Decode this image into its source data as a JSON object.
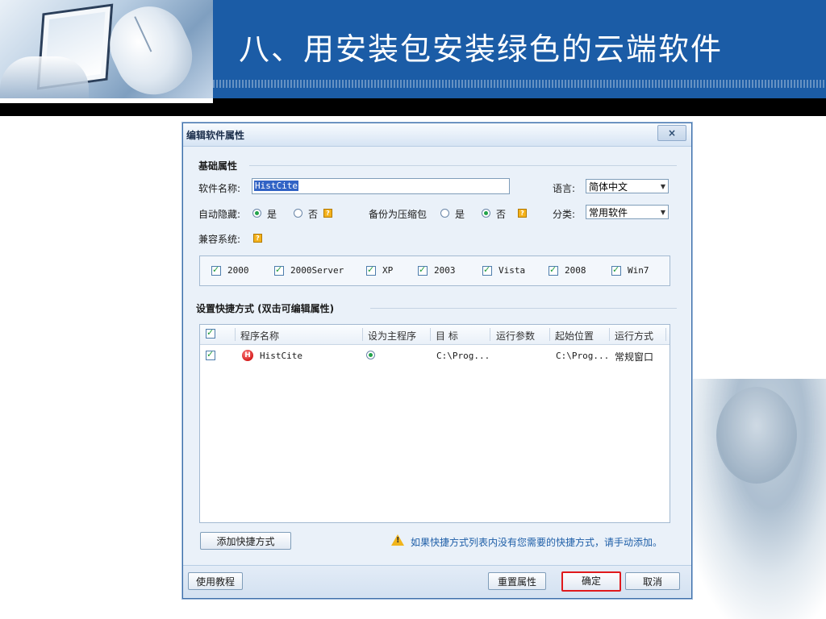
{
  "slide": {
    "title": "八、用安装包安装绿色的云端软件"
  },
  "dialog": {
    "title": "编辑软件属性",
    "close_label": "×",
    "basic": {
      "section_label": "基础属性",
      "name_label": "软件名称:",
      "name_value": "HistCite",
      "lang_label": "语言:",
      "lang_value": "简体中文",
      "hide_label": "自动隐藏:",
      "yes_label": "是",
      "no_label": "否",
      "hide_value": "是",
      "backup_label": "备份为压缩包",
      "backup_value": "否",
      "category_label": "分类:",
      "category_value": "常用软件",
      "compat_label": "兼容系统:",
      "help_glyph": "?",
      "os": [
        "2000",
        "2000Server",
        "XP",
        "2003",
        "Vista",
        "2008",
        "Win7"
      ]
    },
    "shortcuts": {
      "section_label": "设置快捷方式 (双击可编辑属性)",
      "columns": [
        "程序名称",
        "设为主程序",
        "目 标",
        "运行参数",
        "起始位置",
        "运行方式"
      ],
      "rows": [
        {
          "icon": "histcite-app-icon",
          "icon_glyph": "H",
          "name": "HistCite",
          "main": true,
          "target": "C:\\Prog...",
          "params": "",
          "startdir": "C:\\Prog...",
          "runmode": "常规窗口"
        }
      ],
      "add_button": "添加快捷方式",
      "hint": "如果快捷方式列表内没有您需要的快捷方式，请手动添加。",
      "warn_icon": "warning-icon"
    },
    "footer": {
      "tutorial_button": "使用教程",
      "reset_button": "重置属性",
      "ok_button": "确定",
      "cancel_button": "取消"
    }
  },
  "colors": {
    "header_blue": "#1b5ca6",
    "highlight_red": "#e0191c",
    "radio_green": "#22a34a"
  }
}
